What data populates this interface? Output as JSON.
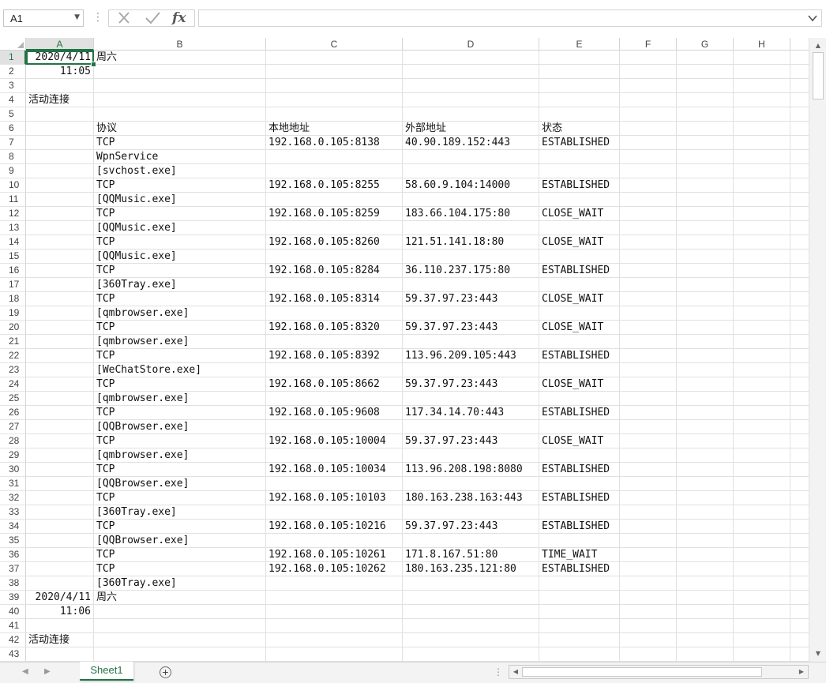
{
  "formula_bar": {
    "name_box": "A1",
    "separator": "⋮",
    "fx": "fx",
    "formula": ""
  },
  "columns": [
    "A",
    "B",
    "C",
    "D",
    "E",
    "F",
    "G",
    "H"
  ],
  "rows": [
    {
      "n": "1",
      "a": "2020/4/11",
      "b": "周六",
      "c": "",
      "d": "",
      "e": ""
    },
    {
      "n": "2",
      "a": "11:05",
      "b": "",
      "c": "",
      "d": "",
      "e": ""
    },
    {
      "n": "3",
      "a": "",
      "b": "",
      "c": "",
      "d": "",
      "e": ""
    },
    {
      "n": "4",
      "a": "活动连接",
      "b": "",
      "c": "",
      "d": "",
      "e": ""
    },
    {
      "n": "5",
      "a": "",
      "b": "",
      "c": "",
      "d": "",
      "e": ""
    },
    {
      "n": "6",
      "a": "",
      "b": "协议",
      "c": "本地地址",
      "d": "外部地址",
      "e": "状态"
    },
    {
      "n": "7",
      "a": "",
      "b": "TCP",
      "c": "192.168.0.105:8138",
      "d": "40.90.189.152:443",
      "e": "ESTABLISHED"
    },
    {
      "n": "8",
      "a": "",
      "b": "WpnService",
      "c": "",
      "d": "",
      "e": ""
    },
    {
      "n": "9",
      "a": "",
      "b": "[svchost.exe]",
      "c": "",
      "d": "",
      "e": ""
    },
    {
      "n": "10",
      "a": "",
      "b": "TCP",
      "c": "192.168.0.105:8255",
      "d": "58.60.9.104:14000",
      "e": "ESTABLISHED"
    },
    {
      "n": "11",
      "a": "",
      "b": "[QQMusic.exe]",
      "c": "",
      "d": "",
      "e": ""
    },
    {
      "n": "12",
      "a": "",
      "b": "TCP",
      "c": "192.168.0.105:8259",
      "d": "183.66.104.175:80",
      "e": "CLOSE_WAIT"
    },
    {
      "n": "13",
      "a": "",
      "b": "[QQMusic.exe]",
      "c": "",
      "d": "",
      "e": ""
    },
    {
      "n": "14",
      "a": "",
      "b": "TCP",
      "c": "192.168.0.105:8260",
      "d": "121.51.141.18:80",
      "e": "CLOSE_WAIT"
    },
    {
      "n": "15",
      "a": "",
      "b": "[QQMusic.exe]",
      "c": "",
      "d": "",
      "e": ""
    },
    {
      "n": "16",
      "a": "",
      "b": "TCP",
      "c": "192.168.0.105:8284",
      "d": "36.110.237.175:80",
      "e": "ESTABLISHED"
    },
    {
      "n": "17",
      "a": "",
      "b": "[360Tray.exe]",
      "c": "",
      "d": "",
      "e": ""
    },
    {
      "n": "18",
      "a": "",
      "b": "TCP",
      "c": "192.168.0.105:8314",
      "d": "59.37.97.23:443",
      "e": "CLOSE_WAIT"
    },
    {
      "n": "19",
      "a": "",
      "b": "[qmbrowser.exe]",
      "c": "",
      "d": "",
      "e": ""
    },
    {
      "n": "20",
      "a": "",
      "b": "TCP",
      "c": "192.168.0.105:8320",
      "d": "59.37.97.23:443",
      "e": "CLOSE_WAIT"
    },
    {
      "n": "21",
      "a": "",
      "b": "[qmbrowser.exe]",
      "c": "",
      "d": "",
      "e": ""
    },
    {
      "n": "22",
      "a": "",
      "b": "TCP",
      "c": "192.168.0.105:8392",
      "d": "113.96.209.105:443",
      "e": "ESTABLISHED"
    },
    {
      "n": "23",
      "a": "",
      "b": "[WeChatStore.exe]",
      "c": "",
      "d": "",
      "e": ""
    },
    {
      "n": "24",
      "a": "",
      "b": "TCP",
      "c": "192.168.0.105:8662",
      "d": "59.37.97.23:443",
      "e": "CLOSE_WAIT"
    },
    {
      "n": "25",
      "a": "",
      "b": "[qmbrowser.exe]",
      "c": "",
      "d": "",
      "e": ""
    },
    {
      "n": "26",
      "a": "",
      "b": "TCP",
      "c": "192.168.0.105:9608",
      "d": "117.34.14.70:443",
      "e": "ESTABLISHED"
    },
    {
      "n": "27",
      "a": "",
      "b": "[QQBrowser.exe]",
      "c": "",
      "d": "",
      "e": ""
    },
    {
      "n": "28",
      "a": "",
      "b": "TCP",
      "c": "192.168.0.105:10004",
      "d": "59.37.97.23:443",
      "e": "CLOSE_WAIT"
    },
    {
      "n": "29",
      "a": "",
      "b": "[qmbrowser.exe]",
      "c": "",
      "d": "",
      "e": ""
    },
    {
      "n": "30",
      "a": "",
      "b": "TCP",
      "c": "192.168.0.105:10034",
      "d": "113.96.208.198:8080",
      "e": "ESTABLISHED"
    },
    {
      "n": "31",
      "a": "",
      "b": "[QQBrowser.exe]",
      "c": "",
      "d": "",
      "e": ""
    },
    {
      "n": "32",
      "a": "",
      "b": "TCP",
      "c": "192.168.0.105:10103",
      "d": "180.163.238.163:443",
      "e": "ESTABLISHED"
    },
    {
      "n": "33",
      "a": "",
      "b": "[360Tray.exe]",
      "c": "",
      "d": "",
      "e": ""
    },
    {
      "n": "34",
      "a": "",
      "b": "TCP",
      "c": "192.168.0.105:10216",
      "d": "59.37.97.23:443",
      "e": "ESTABLISHED"
    },
    {
      "n": "35",
      "a": "",
      "b": "[QQBrowser.exe]",
      "c": "",
      "d": "",
      "e": ""
    },
    {
      "n": "36",
      "a": "",
      "b": "TCP",
      "c": "192.168.0.105:10261",
      "d": "171.8.167.51:80",
      "e": "TIME_WAIT"
    },
    {
      "n": "37",
      "a": "",
      "b": "TCP",
      "c": "192.168.0.105:10262",
      "d": "180.163.235.121:80",
      "e": "ESTABLISHED"
    },
    {
      "n": "38",
      "a": "",
      "b": "[360Tray.exe]",
      "c": "",
      "d": "",
      "e": ""
    },
    {
      "n": "39",
      "a": "2020/4/11",
      "b": "周六",
      "c": "",
      "d": "",
      "e": ""
    },
    {
      "n": "40",
      "a": "11:06",
      "b": "",
      "c": "",
      "d": "",
      "e": ""
    },
    {
      "n": "41",
      "a": "",
      "b": "",
      "c": "",
      "d": "",
      "e": ""
    },
    {
      "n": "42",
      "a": "活动连接",
      "b": "",
      "c": "",
      "d": "",
      "e": ""
    },
    {
      "n": "43",
      "a": "",
      "b": "",
      "c": "",
      "d": "",
      "e": ""
    }
  ],
  "sheet_tabs": [
    "Sheet1"
  ],
  "add_sheet": "+",
  "colors": {
    "accent": "#217346",
    "gridline": "#e1e1e1",
    "header_selected": "#e1e1e1"
  }
}
